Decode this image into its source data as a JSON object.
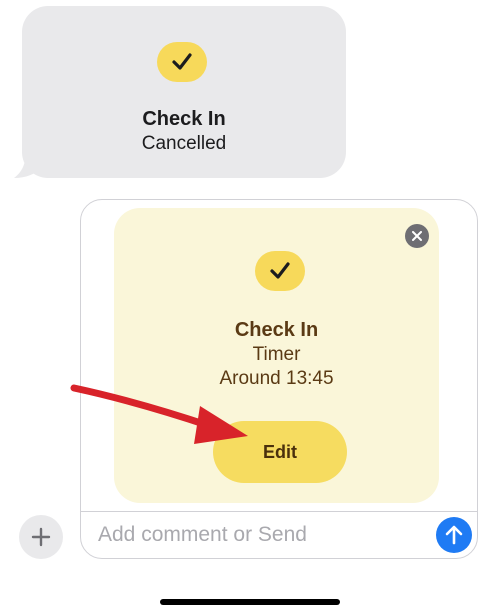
{
  "received_message": {
    "title": "Check In",
    "status": "Cancelled",
    "icon": "checkmark-icon"
  },
  "checkin_card": {
    "title": "Check In",
    "mode": "Timer",
    "time": "Around 13:45",
    "edit_label": "Edit",
    "icon": "checkmark-icon"
  },
  "composer": {
    "placeholder": "Add comment or Send"
  },
  "colors": {
    "accent_yellow": "#f7d95a",
    "card_bg": "#faf6d9",
    "send_blue": "#1f7bf4",
    "bubble_gray": "#e9e9eb",
    "annotation_red": "#d8232a"
  }
}
